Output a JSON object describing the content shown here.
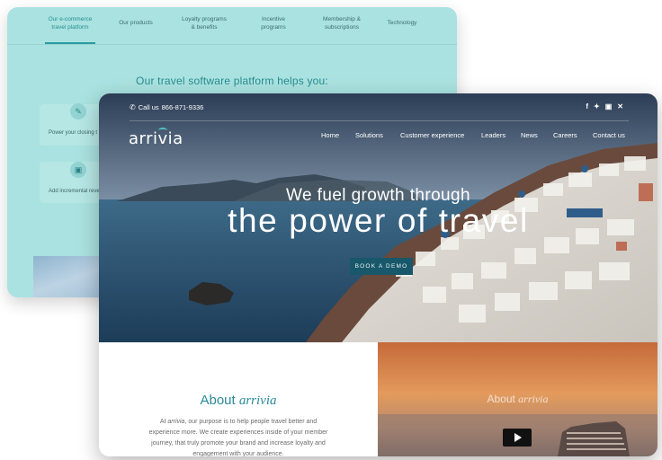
{
  "back_card": {
    "nav": [
      {
        "label": "Our e-commerce\ntravel platform",
        "active": true
      },
      {
        "label": "Our products"
      },
      {
        "label": "Loyalty programs\n& benefits"
      },
      {
        "label": "Incentive\nprograms"
      },
      {
        "label": "Membership &\nsubscriptions"
      },
      {
        "label": "Technology"
      }
    ],
    "heading": "Our travel software platform helps you:",
    "features": [
      {
        "icon": "leaf-icon",
        "text": "Power your closing t"
      },
      {
        "icon": "monitor-icon",
        "text": "Add incremental reve"
      }
    ]
  },
  "front_card": {
    "topbar": {
      "call_label": "Call us",
      "phone": "866-871-9336",
      "social_icons": [
        "facebook-icon",
        "twitter-icon",
        "linkedin-icon",
        "xing-icon"
      ]
    },
    "logo": "arrivia",
    "nav": [
      "Home",
      "Solutions",
      "Customer experience",
      "Leaders",
      "News",
      "Careers",
      "Contact us"
    ],
    "hero": {
      "line1": "We fuel growth through",
      "line2": "the power of travel",
      "cta": "BOOK A DEMO"
    },
    "about": {
      "title_prefix": "About ",
      "title_brand": "arrivia",
      "body_pre": "At ",
      "body_brand": "arrivia",
      "body_post": ", our purpose is to help people travel better and experience more. We create experiences inside of your member journey, that truly promote your brand and increase loyalty and engagement with your audience."
    },
    "video": {
      "title_prefix": "About ",
      "title_brand": "arrivia",
      "play_icon": "play-icon"
    }
  },
  "colors": {
    "back_bg": "#a9e2e0",
    "accent_teal": "#2a8c90",
    "cta_bg": "#18586a"
  }
}
